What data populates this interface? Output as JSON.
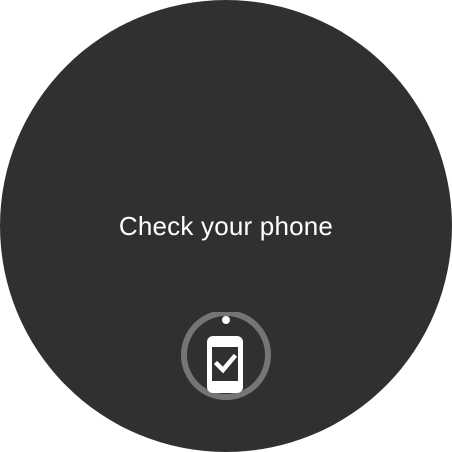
{
  "screen": {
    "message": "Check your phone"
  },
  "indicator": {
    "icon": "phone-check-icon",
    "progress": 0.0,
    "ring_color": "#757575",
    "dot_color": "#ffffff",
    "phone_color": "#ffffff",
    "check_color": "#303030"
  },
  "colors": {
    "background": "#303030",
    "text": "#ffffff"
  }
}
